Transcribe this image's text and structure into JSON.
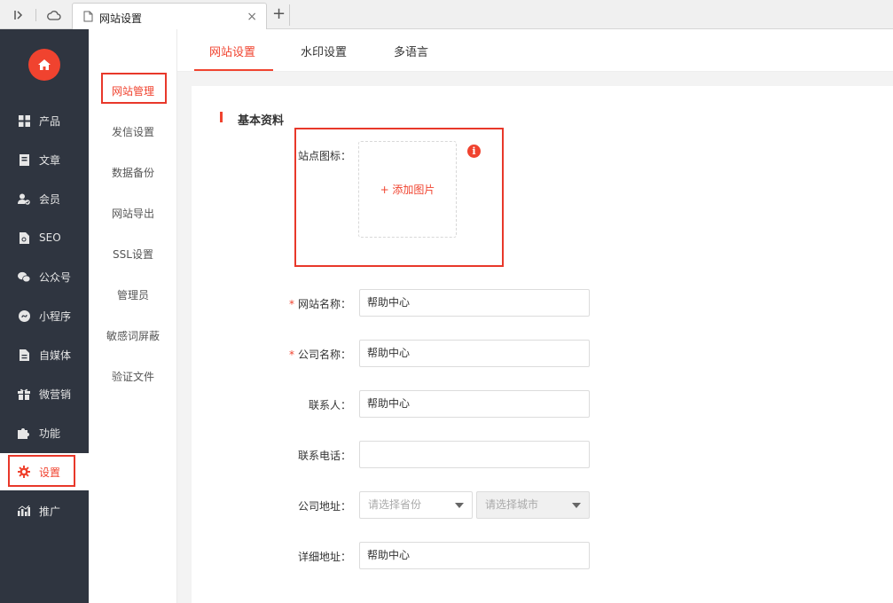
{
  "browser": {
    "tab_title": "网站设置",
    "tab_close": "×",
    "new_tab": "+"
  },
  "sidebar": {
    "items": [
      {
        "label": "产品",
        "icon": "grid-icon"
      },
      {
        "label": "文章",
        "icon": "document-icon"
      },
      {
        "label": "会员",
        "icon": "user-check-icon"
      },
      {
        "label": "SEO",
        "icon": "seo-file-icon"
      },
      {
        "label": "公众号",
        "icon": "wechat-icon"
      },
      {
        "label": "小程序",
        "icon": "mini-program-icon"
      },
      {
        "label": "自媒体",
        "icon": "media-file-icon"
      },
      {
        "label": "微营销",
        "icon": "gift-icon"
      },
      {
        "label": "功能",
        "icon": "puzzle-icon"
      },
      {
        "label": "设置",
        "icon": "gear-icon",
        "active": true
      },
      {
        "label": "推广",
        "icon": "chart-icon"
      }
    ]
  },
  "submenu": {
    "items": [
      "网站管理",
      "发信设置",
      "数据备份",
      "网站导出",
      "SSL设置",
      "管理员",
      "敏感词屏蔽",
      "验证文件"
    ]
  },
  "topnav": {
    "tabs": [
      "网站设置",
      "水印设置",
      "多语言"
    ]
  },
  "form": {
    "section_title": "基本资料",
    "logo_label": "站点图标：",
    "add_image": "+  添加图片",
    "info_glyph": "i",
    "required_mark": "*",
    "site_name_label": "网站名称：",
    "site_name_value": "帮助中心",
    "company_name_label": "公司名称：",
    "company_name_value": "帮助中心",
    "contact_label": "联系人：",
    "contact_value": "帮助中心",
    "phone_label": "联系电话：",
    "phone_value": "",
    "address_label": "公司地址：",
    "province_placeholder": "请选择省份",
    "city_placeholder": "请选择城市",
    "detail_label": "详细地址：",
    "detail_value": "帮助中心"
  },
  "colors": {
    "accent": "#f0432f",
    "sidebar_bg": "#2f3540"
  }
}
